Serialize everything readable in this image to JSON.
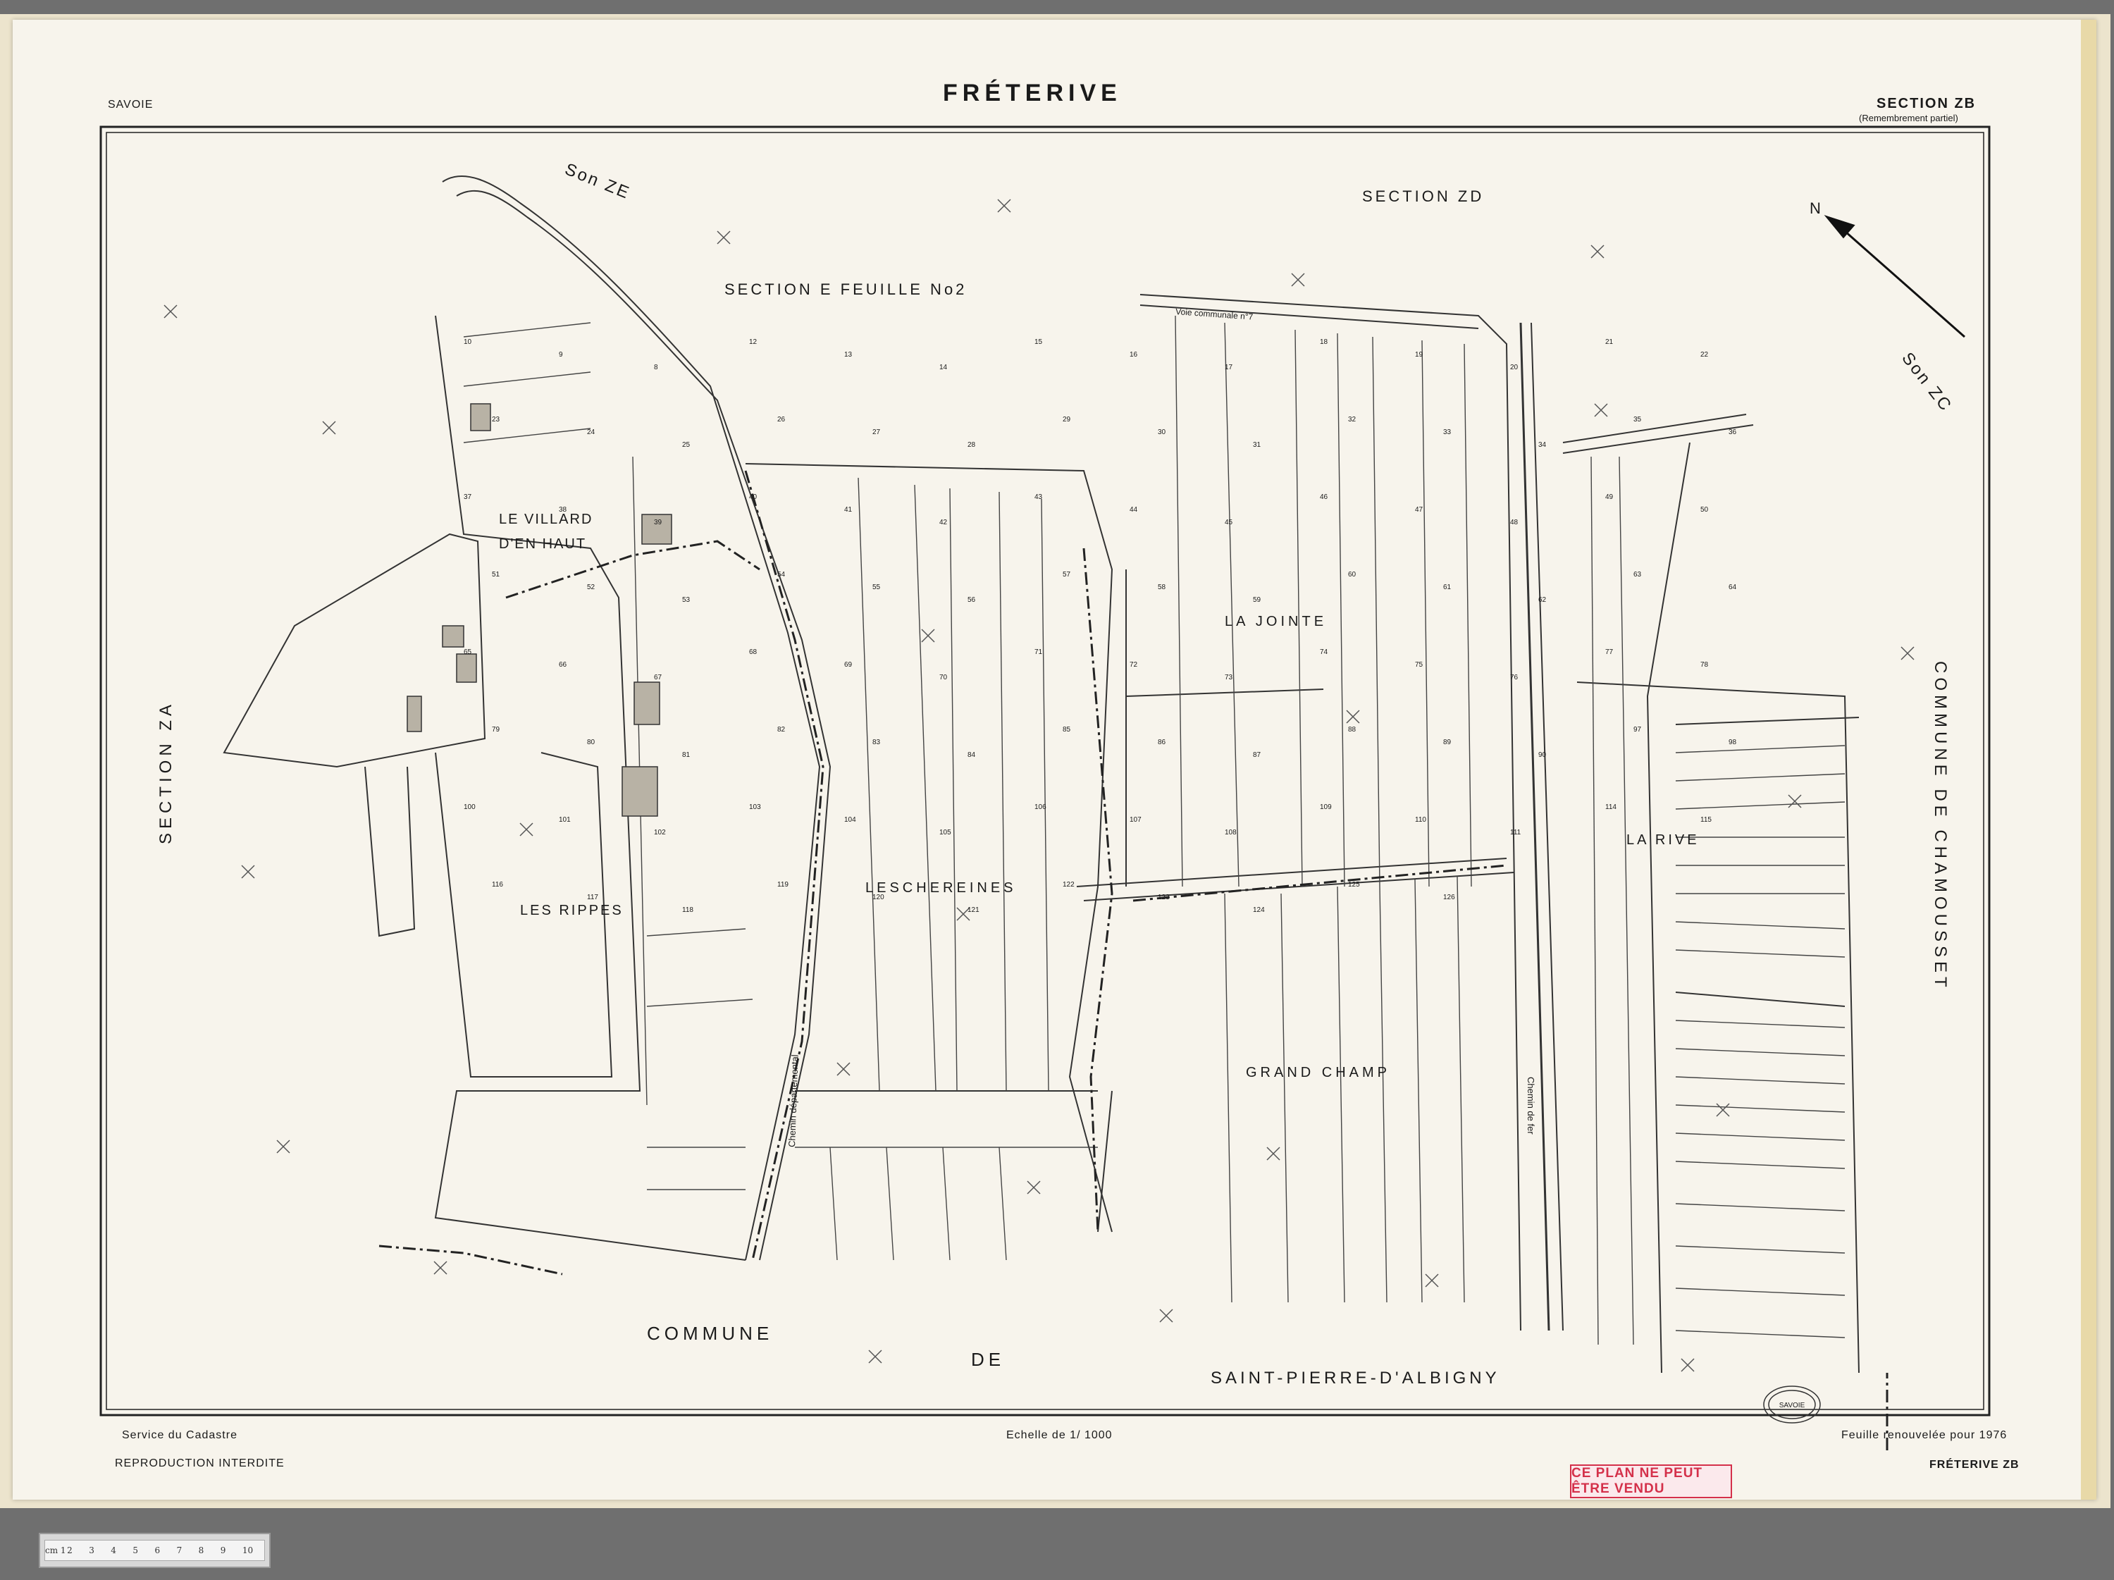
{
  "header": {
    "region": "SAVOIE",
    "title": "FRÉTERIVE",
    "section": "SECTION ZB",
    "section_note": "(Remembrement partiel)"
  },
  "footer": {
    "service": "Service du Cadastre",
    "reproduction": "REPRODUCTION INTERDITE",
    "scale": "Echelle de 1/ 1000",
    "renewed": "Feuille renouvelée pour 1976",
    "sheet_id": "FRÉTERIVE ZB",
    "stamp": "CE PLAN NE PEUT ÊTRE VENDU",
    "seal_lines": [
      "SAVOIE"
    ]
  },
  "map": {
    "neighbors": {
      "son_ze": "Son ZE",
      "section_zd": "SECTION   ZD",
      "section_e": "SECTION   E   FEUILLE  No2",
      "son_zc": "Son ZC",
      "section_za": "SECTION   ZA",
      "commune_chamousset": "COMMUNE  DE  CHAMOUSSET",
      "commune_label": "COMMUNE",
      "de_label": "DE",
      "saint_pierre": "SAINT-PIERRE-D'ALBIGNY"
    },
    "places": {
      "villard_1": "LE VILLARD",
      "villard_2": "D'EN HAUT",
      "rippes": "LES  RIPPES",
      "chereines": "LESCHEREINES",
      "jointe": "LA  JOINTE",
      "grand_champ": "GRAND  CHAMP",
      "rive": "LA RIVE"
    },
    "roads": {
      "cd": "Chemin départemental",
      "fer": "Chemin de fer",
      "voie": "Voie communale n°7"
    },
    "north": "N",
    "parcels": [
      "10",
      "9",
      "8",
      "12",
      "13",
      "14",
      "15",
      "16",
      "17",
      "18",
      "19",
      "20",
      "21",
      "22",
      "23",
      "24",
      "25",
      "26",
      "27",
      "28",
      "29",
      "30",
      "31",
      "32",
      "33",
      "34",
      "35",
      "36",
      "37",
      "38",
      "39",
      "40",
      "41",
      "42",
      "43",
      "44",
      "45",
      "46",
      "47",
      "48",
      "49",
      "50",
      "51",
      "52",
      "53",
      "54",
      "55",
      "56",
      "57",
      "58",
      "59",
      "60",
      "61",
      "62",
      "63",
      "64",
      "65",
      "66",
      "67",
      "68",
      "69",
      "70",
      "71",
      "72",
      "73",
      "74",
      "75",
      "76",
      "77",
      "78",
      "79",
      "80",
      "81",
      "82",
      "83",
      "84",
      "85",
      "86",
      "87",
      "88",
      "89",
      "90",
      "97",
      "98",
      "100",
      "101",
      "102",
      "103",
      "104",
      "105",
      "106",
      "107",
      "108",
      "109",
      "110",
      "111",
      "114",
      "115",
      "116",
      "117",
      "118",
      "119",
      "120",
      "121",
      "122",
      "123",
      "124",
      "125",
      "126"
    ]
  },
  "ruler": {
    "marks": [
      "cm 1",
      "2",
      "3",
      "4",
      "5",
      "6",
      "7",
      "8",
      "9",
      "10"
    ]
  }
}
